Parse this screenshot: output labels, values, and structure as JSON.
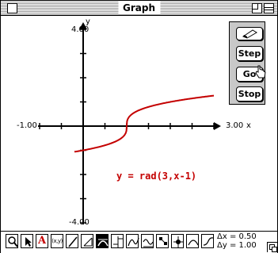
{
  "window": {
    "title": "Graph"
  },
  "graph": {
    "y_axis_label": "y",
    "x_axis_label": "x",
    "y_max_label": "4.00",
    "y_min_label": "-4.00",
    "x_min_label": "-1.00",
    "x_max_label": "3.00",
    "equation": "y = rad(3,x-1)",
    "curve_color": "#c40000"
  },
  "controls": {
    "eraser_icon": "eraser-icon",
    "step_label": "Step",
    "go_label": "Go",
    "stop_label": "Stop"
  },
  "toolbar": {
    "tools": [
      "zoom-icon",
      "arrow-icon",
      "text-A-icon",
      "coordinates-icon",
      "line-icon",
      "slope-icon",
      "tangent-icon",
      "piecewise-icon",
      "function-icon",
      "wave-icon",
      "node-icon",
      "crosshair-icon",
      "hump-icon",
      "curve-icon"
    ],
    "text_tool_label": "A",
    "xy_tool_label": "(x,y)",
    "dx_label": "Δx = 0.50",
    "dy_label": "Δy = 1.00"
  },
  "chart_data": {
    "type": "line",
    "title": "y = rad(3,x-1)",
    "xlabel": "x",
    "ylabel": "y",
    "xlim": [
      -1.0,
      3.0
    ],
    "ylim": [
      -4.0,
      4.0
    ],
    "x_tick_step": 0.5,
    "y_tick_step": 1.0,
    "series": [
      {
        "name": "y = rad(3,x-1)",
        "function": "cube root of (x-1)",
        "x": [
          -0.2,
          0,
          0.5,
          0.9,
          0.99,
          1.0,
          1.01,
          1.1,
          1.5,
          2.0,
          2.5,
          3.0
        ],
        "y": [
          -1.06,
          -1.0,
          -0.79,
          -0.46,
          -0.22,
          0.0,
          0.22,
          0.46,
          0.79,
          1.0,
          1.14,
          1.26
        ]
      }
    ]
  }
}
